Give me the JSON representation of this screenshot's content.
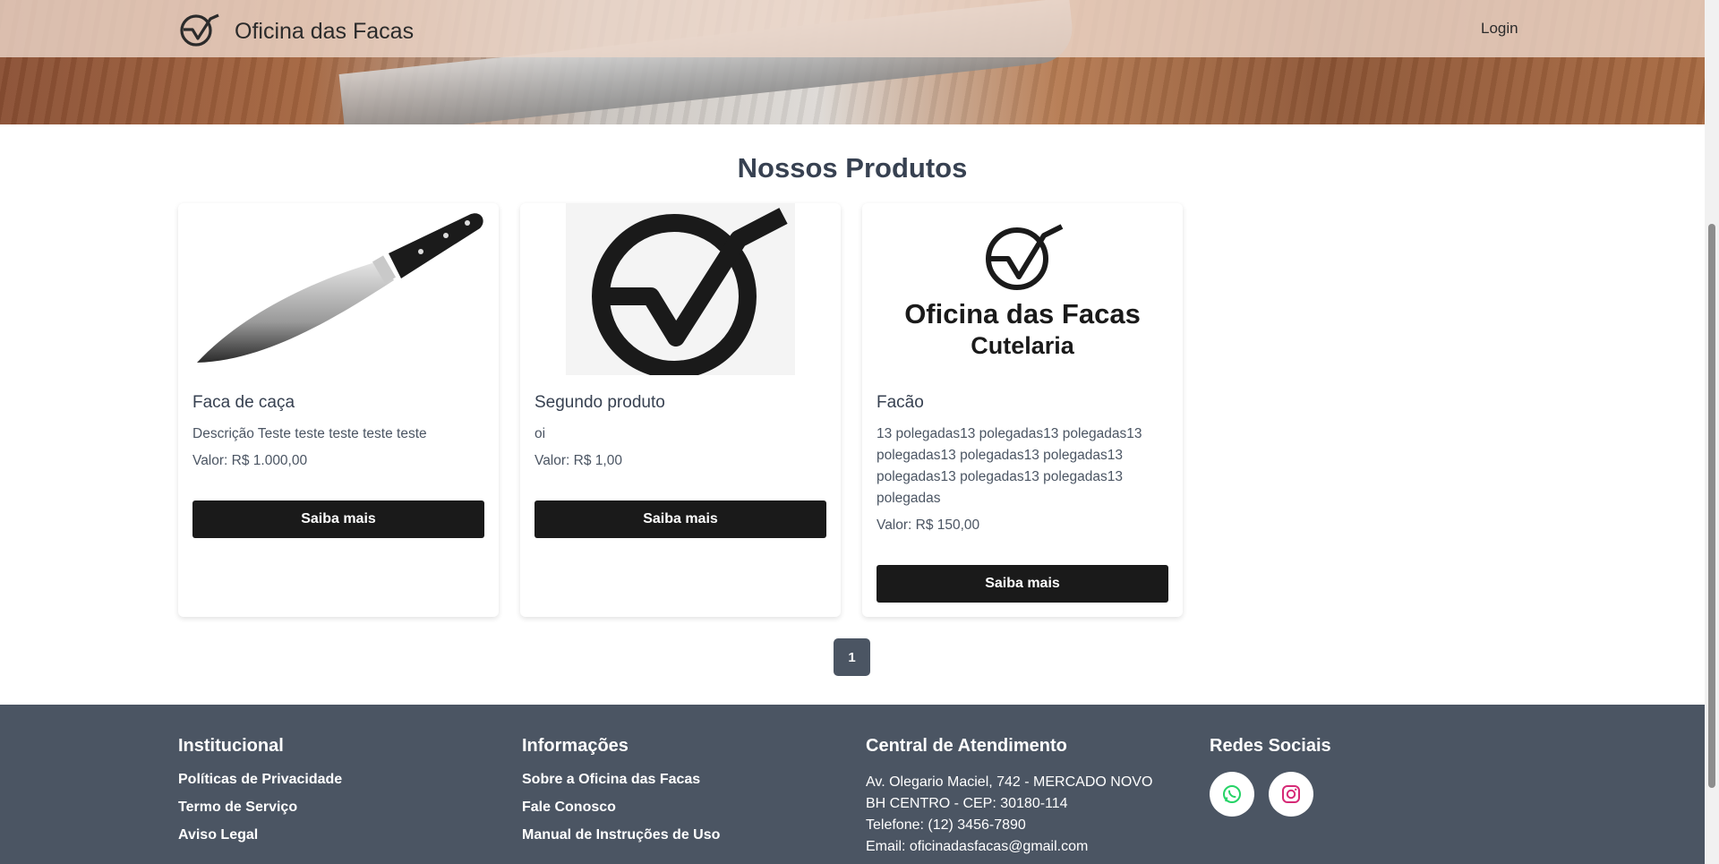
{
  "header": {
    "brand_name": "Oficina das Facas",
    "login_label": "Login"
  },
  "products": {
    "title": "Nossos Produtos",
    "items": [
      {
        "name": "Faca de caça",
        "description": "Descrição Teste teste teste teste teste",
        "price": "Valor: R$ 1.000,00",
        "button": "Saiba mais",
        "image": "chef-knife-image"
      },
      {
        "name": "Segundo produto",
        "description": "oi",
        "price": "Valor: R$ 1,00",
        "button": "Saiba mais",
        "image": "logo-mark-image"
      },
      {
        "name": "Facão",
        "description": "13 polegadas13 polegadas13 polegadas13 polegadas13 polegadas13 polegadas13 polegadas13 polegadas13 polegadas13 polegadas",
        "price": "Valor: R$ 150,00",
        "button": "Saiba mais",
        "image": "logo-wordmark-image",
        "image_line1": "Oficina das Facas",
        "image_line2": "Cutelaria"
      }
    ],
    "pagination": {
      "current_page": "1"
    }
  },
  "footer": {
    "institucional": {
      "title": "Institucional",
      "links": [
        "Políticas de Privacidade",
        "Termo de Serviço",
        "Aviso Legal"
      ]
    },
    "informacoes": {
      "title": "Informações",
      "links": [
        "Sobre a Oficina das Facas",
        "Fale Conosco",
        "Manual de Instruções de Uso"
      ]
    },
    "atendimento": {
      "title": "Central de Atendimento",
      "lines": [
        "Av. Olegario Maciel, 742 - MERCADO NOVO",
        "BH CENTRO - CEP: 30180-114",
        "Telefone: (12) 3456-7890",
        "Email: oficinadasfacas@gmail.com"
      ]
    },
    "redes": {
      "title": "Redes Sociais",
      "icons": [
        "whatsapp-icon",
        "instagram-icon"
      ]
    }
  },
  "colors": {
    "button_bg": "#1a1a1a",
    "footer_bg": "#4b5563",
    "whatsapp": "#25d366",
    "instagram": "#d62976"
  }
}
